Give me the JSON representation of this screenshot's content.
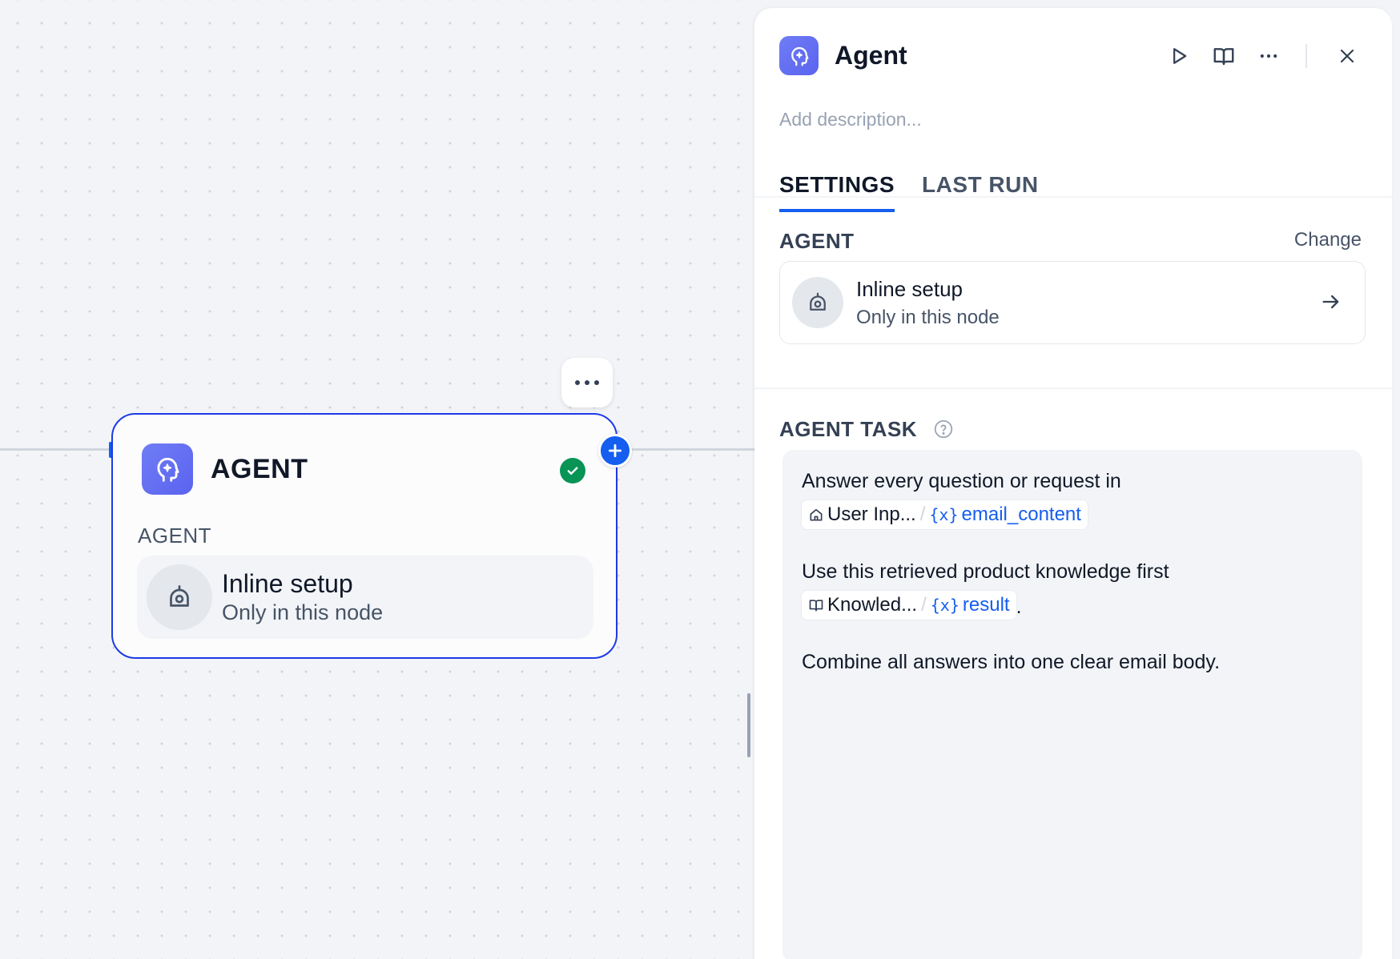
{
  "canvas": {
    "node": {
      "title": "AGENT",
      "status": "success",
      "section_label": "AGENT",
      "card": {
        "title": "Inline setup",
        "subtitle": "Only in this node"
      }
    }
  },
  "panel": {
    "title": "Agent",
    "description_placeholder": "Add description...",
    "tabs": [
      {
        "label": "SETTINGS",
        "active": true
      },
      {
        "label": "LAST RUN",
        "active": false
      }
    ],
    "agent_section": {
      "label": "AGENT",
      "change_label": "Change",
      "card": {
        "title": "Inline setup",
        "subtitle": "Only in this node"
      }
    },
    "task_section": {
      "label": "AGENT TASK",
      "line1": "Answer every question or request in",
      "chip1": {
        "source": "User Inp...",
        "variable": "email_content"
      },
      "line2": "Use this retrieved product knowledge first",
      "chip2": {
        "source": "Knowled...",
        "variable": "result",
        "suffix": "."
      },
      "line3": "Combine all answers into one clear email body."
    }
  },
  "colors": {
    "accent": "#155eef",
    "agent_icon": "#6172f3",
    "success": "#079455",
    "node_border": "#1d3ae6"
  },
  "icons": [
    "agent-head-icon",
    "check-icon",
    "plus-icon",
    "ellipsis-icon",
    "play-icon",
    "book-icon",
    "close-icon",
    "robot-icon",
    "arrow-right-icon",
    "help-icon",
    "home-icon",
    "variable-icon"
  ]
}
